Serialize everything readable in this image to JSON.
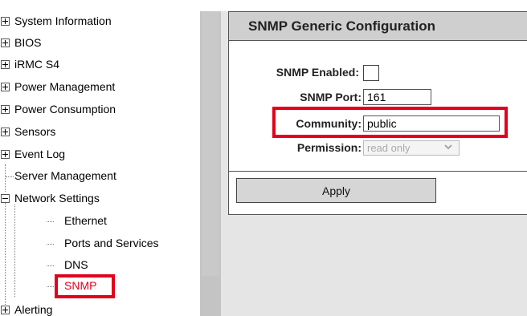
{
  "sidebar": {
    "items": [
      {
        "label": "System Information"
      },
      {
        "label": "BIOS"
      },
      {
        "label": "iRMC S4"
      },
      {
        "label": "Power Management"
      },
      {
        "label": "Power Consumption"
      },
      {
        "label": "Sensors"
      },
      {
        "label": "Event Log"
      },
      {
        "label": "Server Management"
      },
      {
        "label": "Network Settings"
      },
      {
        "label": "Alerting"
      }
    ],
    "network_children": [
      {
        "label": "Ethernet"
      },
      {
        "label": "Ports and Services"
      },
      {
        "label": "DNS"
      },
      {
        "label": "SNMP"
      }
    ]
  },
  "panel": {
    "title": "SNMP Generic Configuration",
    "fields": {
      "enabled_label": "SNMP Enabled:",
      "port_label": "SNMP Port:",
      "port_value": "161",
      "community_label": "Community:",
      "community_value": "public",
      "permission_label": "Permission:",
      "permission_value": "read only"
    },
    "apply_label": "Apply"
  },
  "colors": {
    "highlight": "#e3001b",
    "header_bg": "#cfcfcf"
  }
}
